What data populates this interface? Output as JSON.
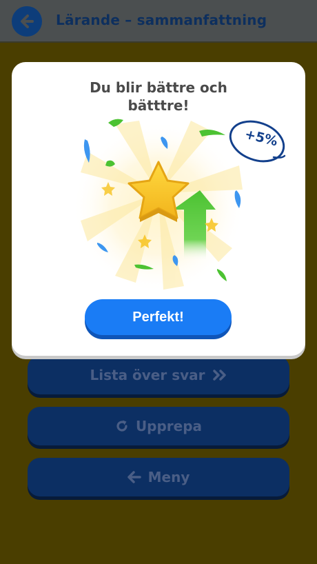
{
  "header": {
    "title": "Lärande – sammanfattning",
    "back_icon": "arrow-left-icon"
  },
  "modal": {
    "title_line1": "Du blir bättre och",
    "title_line2": "bätttre!",
    "badge": "+5%",
    "button_label": "Perfekt!",
    "illustration_icons": [
      "star-icon",
      "arrow-up-icon",
      "confetti-icon"
    ]
  },
  "actions": {
    "list_label": "Lista över svar",
    "list_icon": "double-chevron-right-icon",
    "repeat_label": "Upprepa",
    "repeat_icon": "refresh-icon",
    "menu_label": "Meny",
    "menu_icon": "arrow-left-icon"
  },
  "colors": {
    "overlay_background": "#4a3e00",
    "header_background": "#4b4f50",
    "primary_blue": "#1a7cf5",
    "dark_blue": "#0c2f63",
    "star_yellow": "#f7c52a",
    "arrow_green": "#4cc232"
  }
}
